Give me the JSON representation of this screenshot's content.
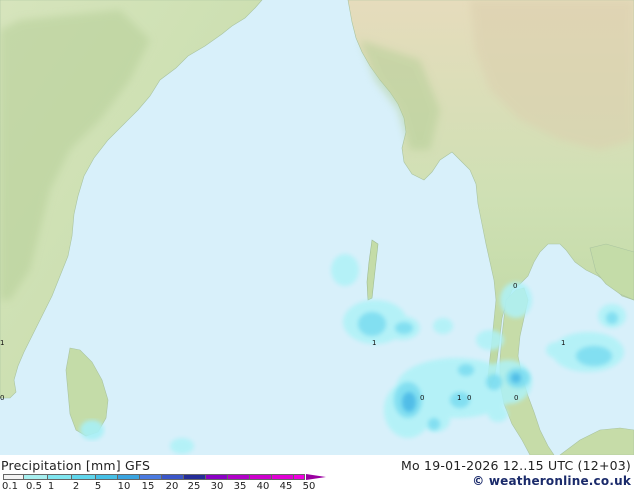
{
  "title": "Precipitation [mm]  GFS",
  "datetime": "Mo 19-01-2026 12..15 UTC (12+03)",
  "credit": "© weatheronline.co.uk",
  "scale": {
    "labels": [
      "0.1",
      "0.5",
      "1",
      "2",
      "5",
      "10",
      "15",
      "20",
      "25",
      "30",
      "35",
      "40",
      "45",
      "50"
    ],
    "colors": [
      "#f4f4f4",
      "#a8f0f0",
      "#80e6f0",
      "#60d6ec",
      "#46c0e6",
      "#3aa4e0",
      "#4a7ae0",
      "#3a55c8",
      "#242c98",
      "#8a00c4",
      "#b000c8",
      "#cc00cc",
      "#e000d4",
      "#f000e0"
    ]
  },
  "map_labels": [
    "1",
    "1",
    "0",
    "1",
    "0",
    "0",
    "0",
    "1",
    "0"
  ],
  "colors": {
    "sea": "#d8f0fa",
    "land_low": "#cfe3b4",
    "land_mid": "#b8d49a",
    "land_high": "#e8dfc4",
    "precip_light": "#a8f0f6",
    "precip_mid": "#72d8ee",
    "precip_strong": "#46b6e4"
  }
}
